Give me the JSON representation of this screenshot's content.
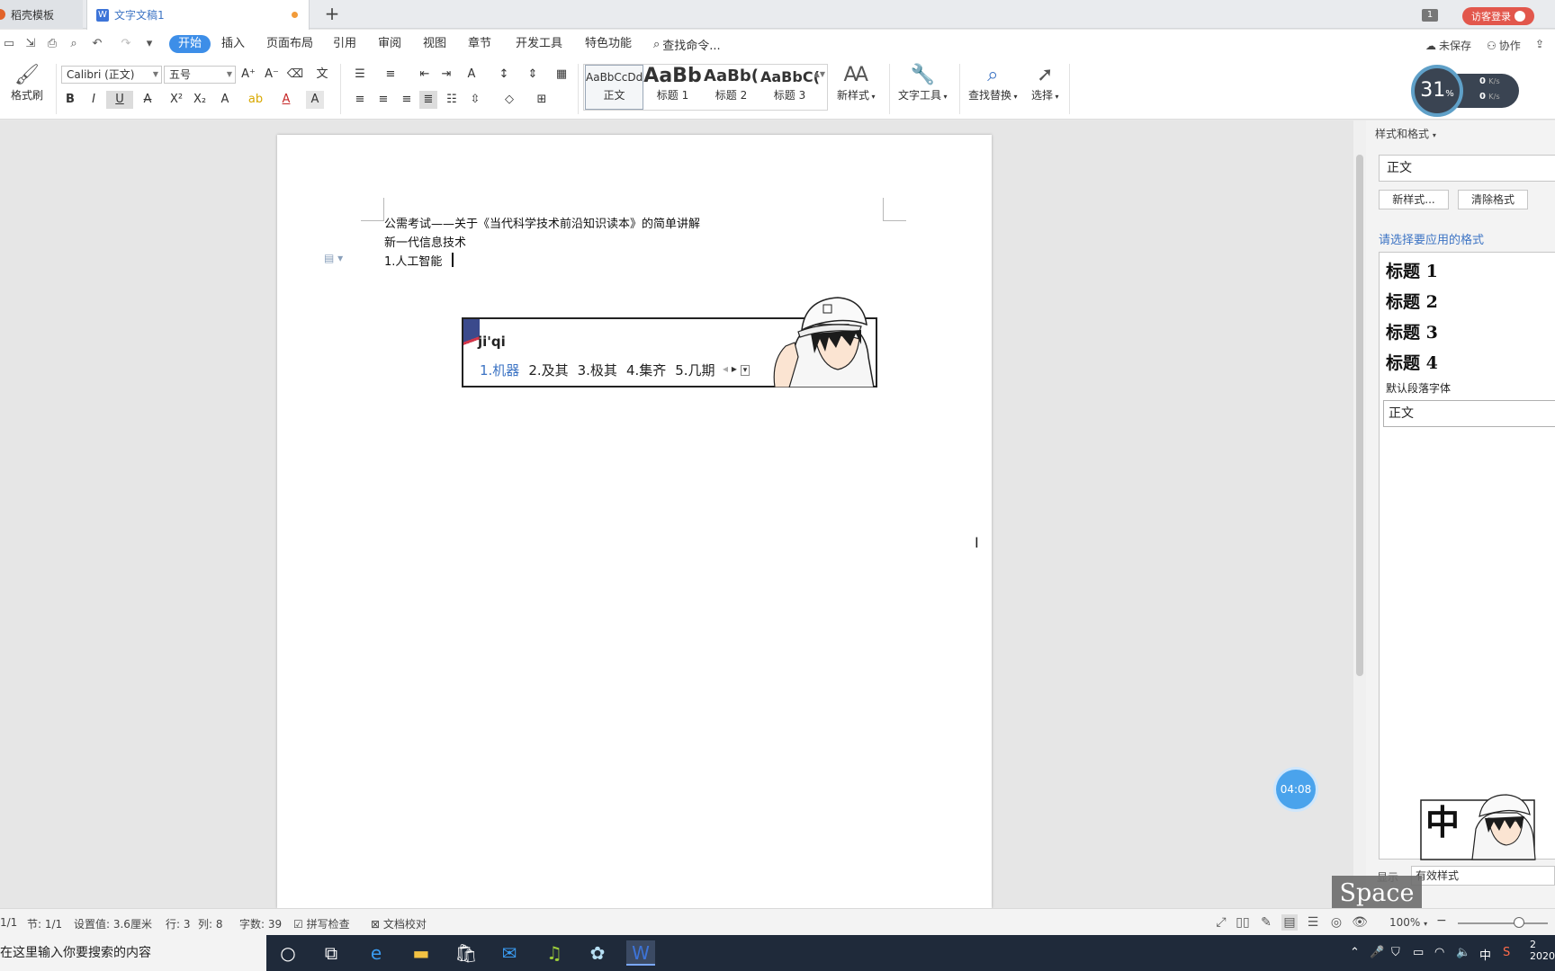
{
  "tabs": [
    {
      "label": "稻壳模板"
    },
    {
      "label": "文字文稿1"
    }
  ],
  "titlebar": {
    "new_tab": "+",
    "window_count": "1",
    "login": "访客登录"
  },
  "menu": {
    "items": [
      "开始",
      "插入",
      "页面布局",
      "引用",
      "审阅",
      "视图",
      "章节",
      "开发工具",
      "特色功能"
    ],
    "search": "查找命令...",
    "unsaved": "未保存",
    "collab": "协作"
  },
  "ribbon": {
    "format_painter": "格式刷",
    "font_name": "Calibri (正文)",
    "font_size": "五号",
    "styles": [
      {
        "preview": "AaBbCcDd",
        "label": "正文"
      },
      {
        "preview": "AaBb",
        "label": "标题 1"
      },
      {
        "preview": "AaBb(",
        "label": "标题 2"
      },
      {
        "preview": "AaBbC(",
        "label": "标题 3"
      }
    ],
    "new_style": "新样式",
    "text_tools": "文字工具",
    "find_replace": "查找替换",
    "select": "选择"
  },
  "speed": {
    "percent": "31",
    "percent_unit": "%",
    "up": "0",
    "down": "0",
    "unit": "K/s"
  },
  "document": {
    "lines": [
      "公需考试——关于《当代科学技术前沿知识读本》的简单讲解",
      "新一代信息技术",
      "1.人工智能"
    ]
  },
  "ime": {
    "composition": "ji'qi",
    "candidates": [
      "1.机器",
      "2.及其",
      "3.极其",
      "4.集齐",
      "5.几期"
    ]
  },
  "timer": "04:08",
  "panel": {
    "title": "样式和格式",
    "current_style": "正文",
    "new_style_btn": "新样式...",
    "clear_btn": "清除格式",
    "hint": "请选择要应用的格式",
    "styles": [
      "标题 1",
      "标题 2",
      "标题 3",
      "标题 4"
    ],
    "default_font": "默认段落字体",
    "body_style": "正文",
    "show_label": "显示",
    "show_value": "有效样式"
  },
  "space_key": "Space",
  "status": {
    "page": "1/1",
    "section": "节: 1/1",
    "setting": "设置值: 3.6厘米",
    "row": "行: 3",
    "col": "列: 8",
    "words": "字数: 39",
    "spell": "拼写检查",
    "proof": "文档校对",
    "zoom": "100%"
  },
  "taskbar": {
    "search_placeholder": "在这里输入你要搜索的内容",
    "ime_lang": "中",
    "clock_time": "2",
    "clock_date": "2020"
  }
}
